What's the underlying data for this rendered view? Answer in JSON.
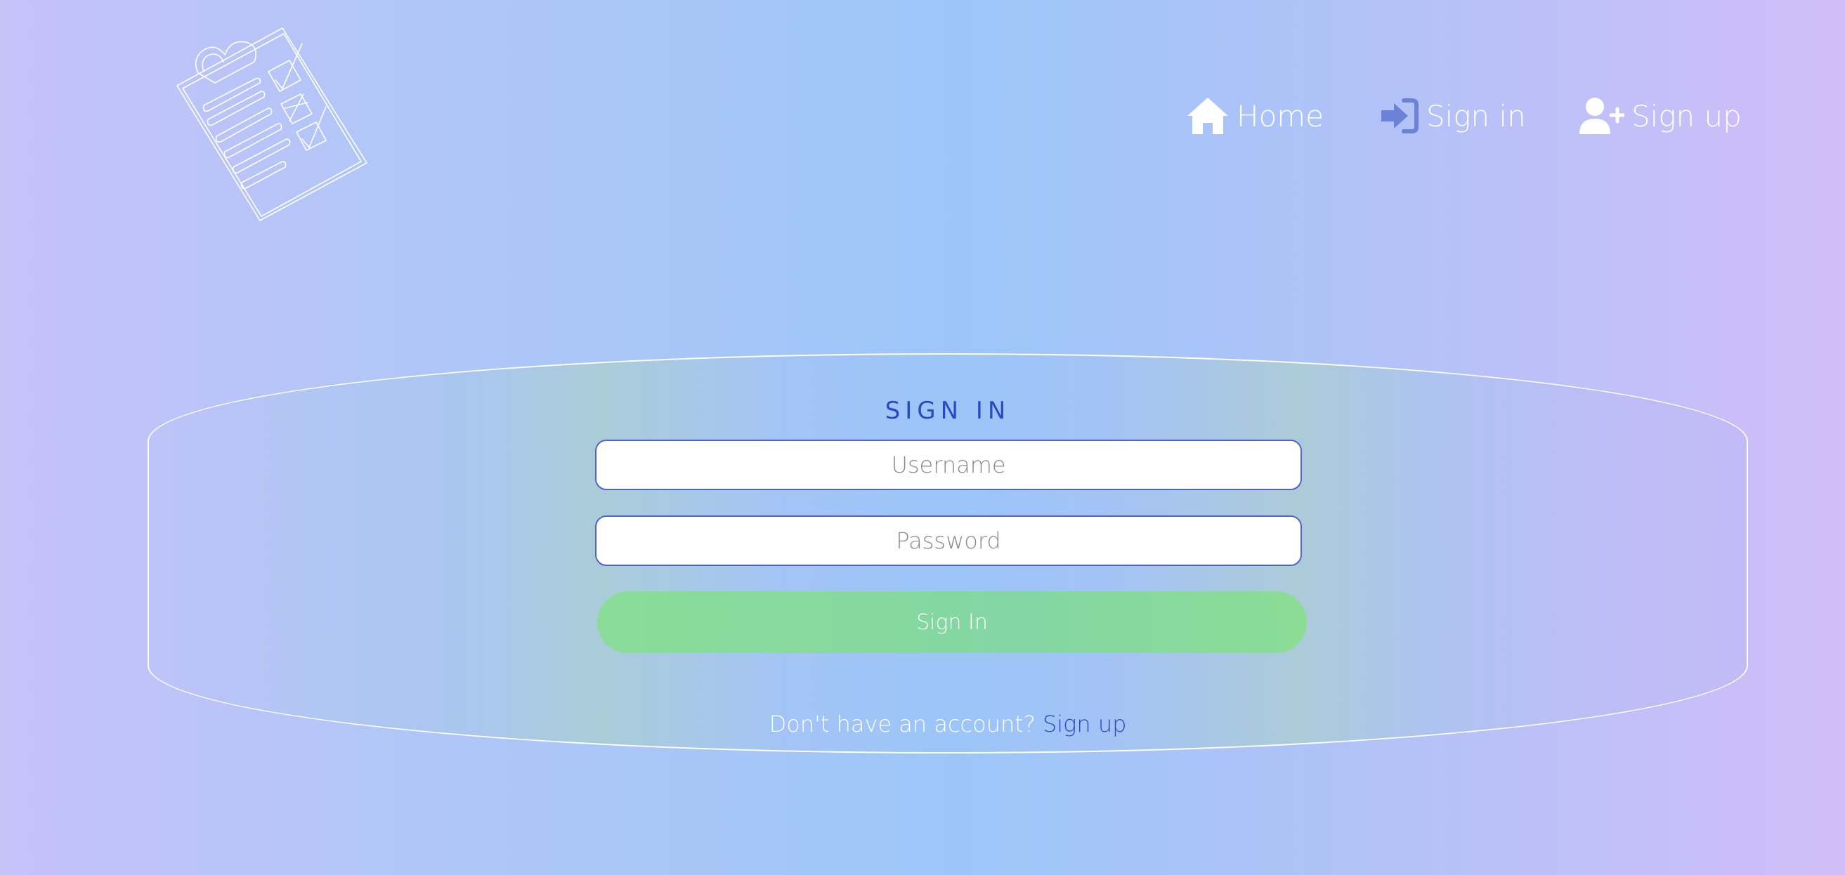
{
  "nav": {
    "home_label": "Home",
    "signin_label": "Sign in",
    "signup_label": "Sign up"
  },
  "form": {
    "title": "SIGN IN",
    "username_placeholder": "Username",
    "password_placeholder": "Password",
    "submit_label": "Sign In",
    "footer_text": "Don't have an account?",
    "footer_link": "Sign up"
  },
  "colors": {
    "accent": "#2f48c2",
    "button": "#8adc98",
    "nav_text": "#ffffff",
    "signin_icon": "#6b82d6"
  },
  "icons": {
    "logo": "clipboard-checklist-icon",
    "home": "home-icon",
    "signin": "sign-in-icon",
    "signup": "user-plus-icon"
  }
}
